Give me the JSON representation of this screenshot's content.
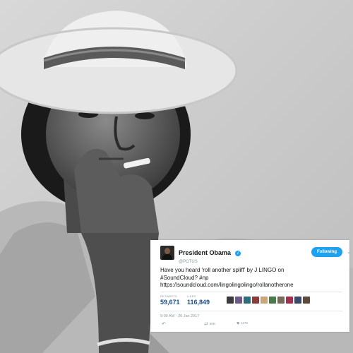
{
  "tweet": {
    "display_name": "President Obama",
    "handle": "@POTUS",
    "follow_label": "Following",
    "text": "Have you heard 'roll another spliff' by J LINGO on\n#SoundCloud? #np\nhttps://soundcloud.com/lingolingolingo/rollanotherone",
    "stats": {
      "retweets_label": "RETWEETS",
      "retweets_value": "59,671",
      "likes_label": "LIKES",
      "likes_value": "116,849"
    },
    "timestamp": "9:09 AM - 20 Jan 2017",
    "actions": {
      "retweet_count": "60K",
      "like_count": "117K"
    },
    "accent_color": "#1da1f2"
  },
  "liker_colors": [
    "#3b3b3b",
    "#6d5a8a",
    "#2d6e7e",
    "#8a3b3b",
    "#c8a878",
    "#4a7a4a",
    "#7a6a5a",
    "#a03050",
    "#3a4a6a",
    "#5e4a3a"
  ]
}
